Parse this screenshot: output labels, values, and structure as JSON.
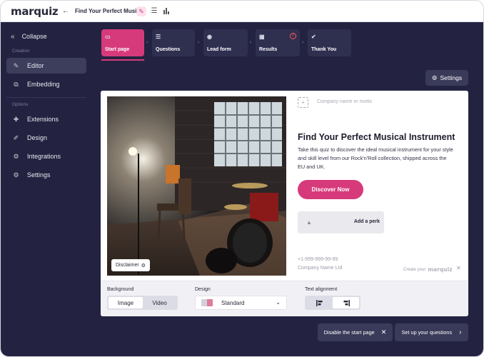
{
  "app": {
    "logo": "marquiz",
    "quiz_title": "Find Your Perfect Musi..."
  },
  "topbar": {
    "back_icon": "arrow-left-icon",
    "edit_icon": "pencil-icon",
    "list_icon": "list-icon",
    "stats_icon": "bar-chart-icon"
  },
  "sidebar": {
    "collapse_label": "Collapse",
    "section_creation": "Creation",
    "section_options": "Options",
    "items": [
      {
        "label": "Editor",
        "icon": "pencil-icon",
        "active": true
      },
      {
        "label": "Embedding",
        "icon": "embed-icon",
        "active": false
      },
      {
        "label": "Extensions",
        "icon": "puzzle-icon",
        "active": false
      },
      {
        "label": "Design",
        "icon": "brush-icon",
        "active": false
      },
      {
        "label": "Integrations",
        "icon": "integrations-icon",
        "active": false
      },
      {
        "label": "Settings",
        "icon": "gear-icon",
        "active": false
      }
    ]
  },
  "steps": [
    {
      "label": "Start page",
      "icon": "window-icon",
      "active": true
    },
    {
      "label": "Questions",
      "icon": "list-icon",
      "active": false
    },
    {
      "label": "Lead form",
      "icon": "contact-icon",
      "active": false
    },
    {
      "label": "Results",
      "icon": "results-icon",
      "active": false,
      "warning": "!"
    },
    {
      "label": "Thank You",
      "icon": "check-badge-icon",
      "active": false
    }
  ],
  "settings_button": "Settings",
  "preview": {
    "disclaimer": "Disclaimer",
    "company_motto_placeholder": "Company name or motto",
    "title": "Find Your Perfect Musical Instrument",
    "description": "Take this quiz to discover the ideal musical instrument for your style and skill level from our Rock'n'Roll collection, shipped across the EU and UK.",
    "cta": "Discover Now",
    "perk": "Add a perk",
    "phone": "+1-999-999-99-99",
    "company_name": "Company Name Ltd",
    "create_your": "Create your",
    "brand": "marquiz"
  },
  "controls": {
    "background_label": "Background",
    "background_options": [
      "Image",
      "Video"
    ],
    "background_selected": "Image",
    "design_label": "Design",
    "design_value": "Standard",
    "text_alignment_label": "Text alignment",
    "text_alignment_selected": "right"
  },
  "footer": {
    "disable_label": "Disable the start page",
    "next_label": "Set up your questions"
  },
  "colors": {
    "accent": "#d63a7b",
    "sidebar": "#232341",
    "step_bg": "#2f2f50"
  }
}
